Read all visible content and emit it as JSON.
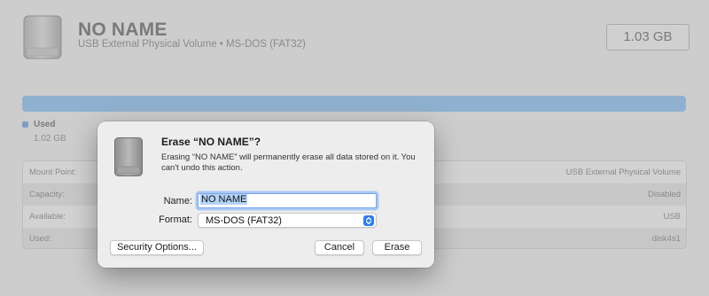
{
  "volume": {
    "title": "NO NAME",
    "subtitle": "USB External Physical Volume • MS-DOS (FAT32)",
    "size": "1.03 GB",
    "usage_fraction": 1.0,
    "used_label": "Used",
    "used_size": "1.02 GB"
  },
  "info_rows": [
    {
      "key": "Mount Point:",
      "value": "USB External Physical Volume"
    },
    {
      "key": "Capacity:",
      "value": "Disabled"
    },
    {
      "key": "Available:",
      "value": "USB"
    },
    {
      "key": "Used:",
      "value": "disk4s1"
    }
  ],
  "dialog": {
    "title": "Erase “NO NAME”?",
    "message": "Erasing “NO NAME” will permanently erase all data stored on it. You can't undo this action.",
    "name_label": "Name:",
    "name_value": "NO NAME",
    "format_label": "Format:",
    "format_value": "MS-DOS (FAT32)",
    "security_button": "Security Options...",
    "cancel_button": "Cancel",
    "erase_button": "Erase"
  },
  "colors": {
    "usage_bar": "#8fb1cf",
    "focus_ring": "#a9c8f3",
    "stepper_blue": "#2e7cf6"
  },
  "icons": [
    "external-drive-icon",
    "popup-stepper-icon"
  ]
}
